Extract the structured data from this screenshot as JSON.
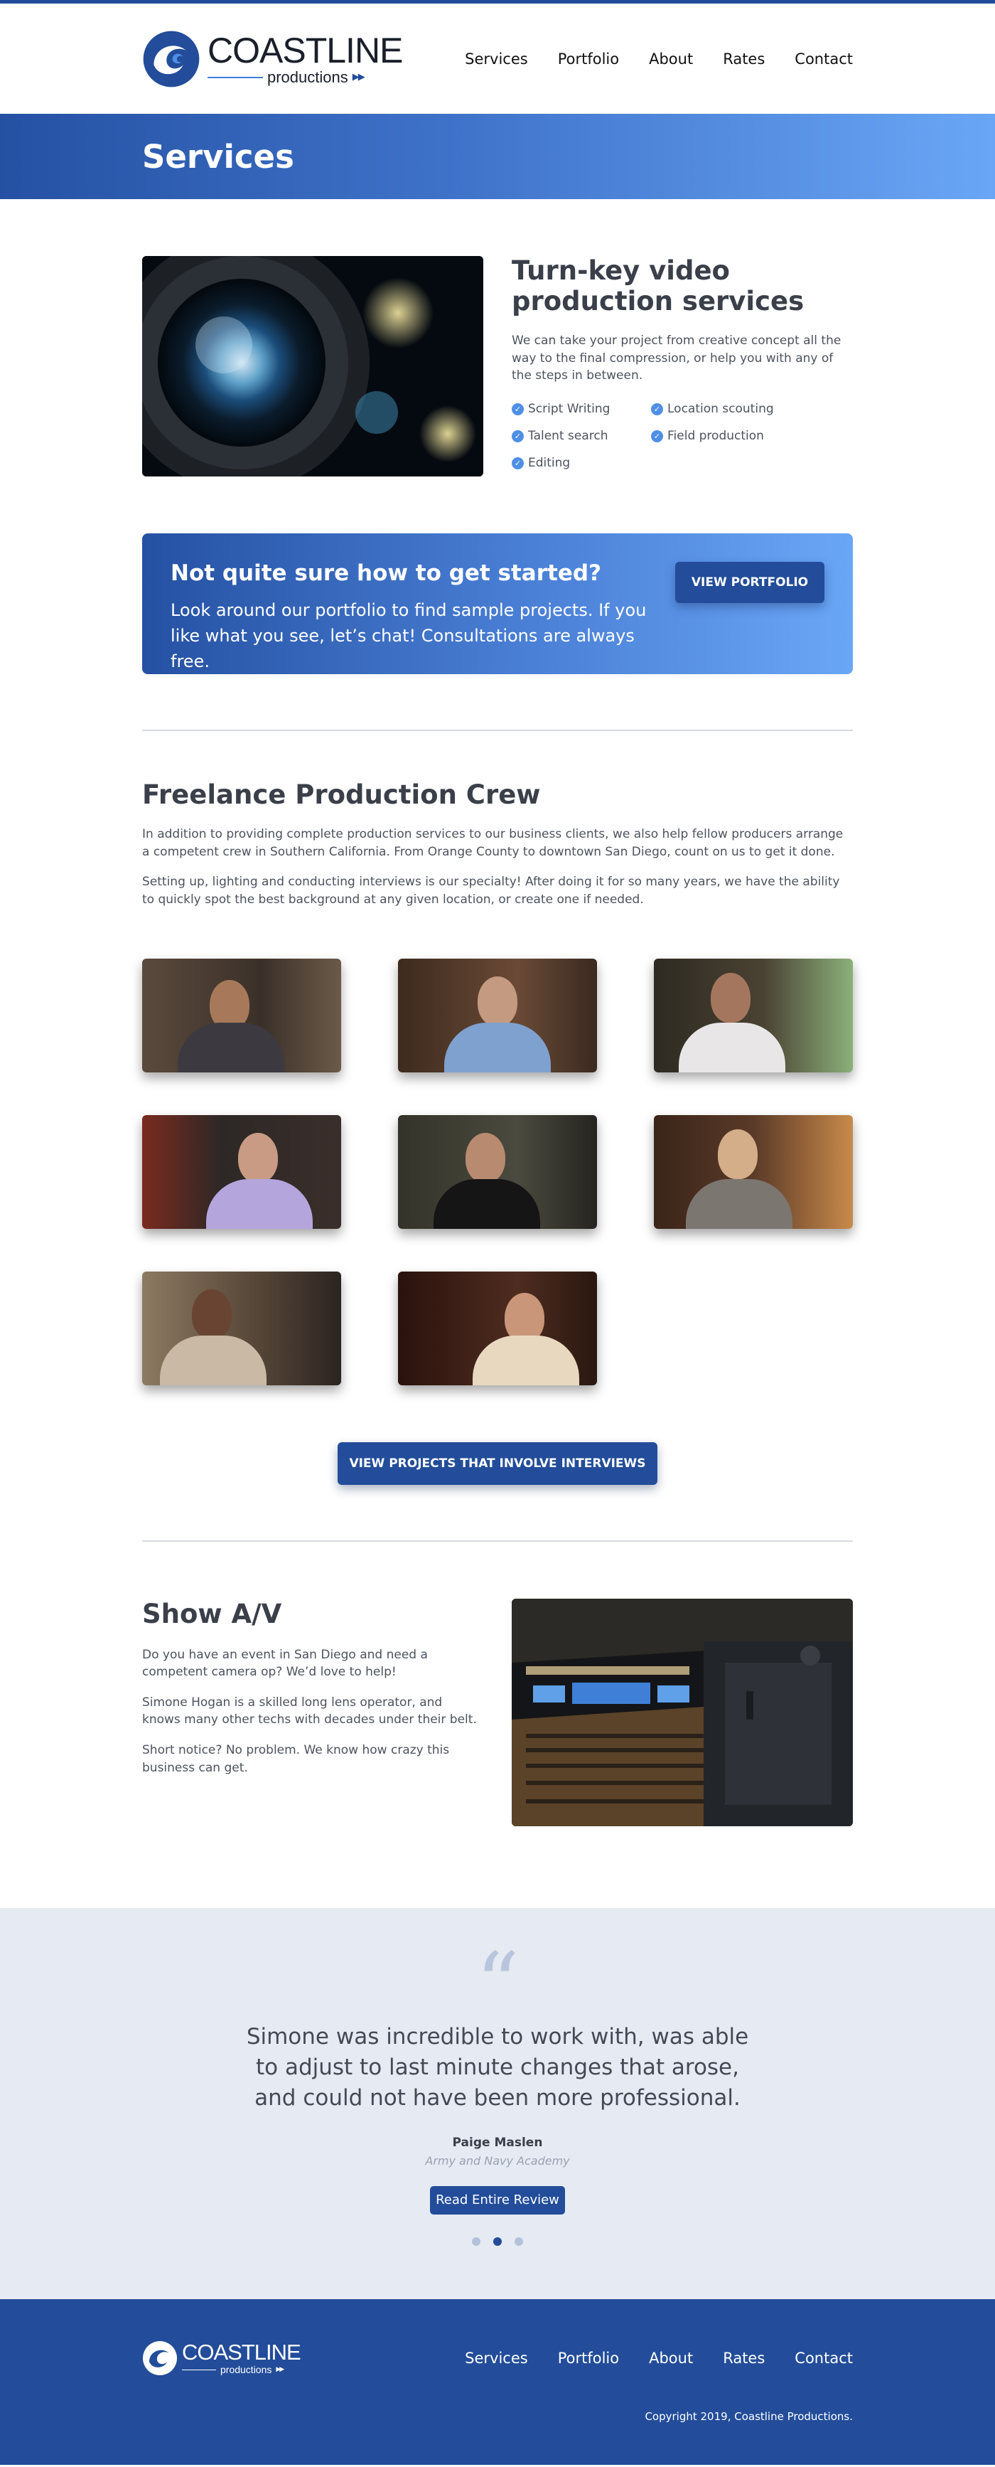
{
  "brand": {
    "name": "COASTLINE",
    "sub": "productions",
    "arrows": "▶▶"
  },
  "nav": {
    "items": [
      "Services",
      "Portfolio",
      "About",
      "Rates",
      "Contact"
    ]
  },
  "banner": {
    "title": "Services"
  },
  "intro": {
    "heading": "Turn-key video production services",
    "body": "We can take your project from creative concept all the way to the final compression, or help you with any of the steps in between.",
    "features": [
      "Script Writing",
      "Location scouting",
      "Talent search",
      "Field production",
      "Editing"
    ]
  },
  "cta": {
    "heading": "Not quite sure how to get started?",
    "body": "Look around our portfolio to find sample projects. If you like what you see, let’s chat! Consultations are always free.",
    "button": "VIEW PORTFOLIO"
  },
  "crew": {
    "heading": "Freelance Production Crew",
    "p1": "In addition to providing complete production services to our business clients, we also help fellow producers arrange a competent crew in Southern California. From Orange County to downtown San Diego, count on us to get it done.",
    "p2": "Setting up, lighting and conducting interviews is our specialty! After doing it for so many years, we have the ability to quickly spot the best background at any given location, or create one if needed.",
    "button": "VIEW PROJECTS THAT INVOLVE INTERVIEWS"
  },
  "show": {
    "heading": "Show A/V",
    "p1": "Do you have an event in San Diego and need a competent camera op? We’d love to help!",
    "p2": "Simone Hogan is a skilled long lens operator, and knows many other techs with decades under their belt.",
    "p3": "Short notice? No problem. We know how crazy this business can get."
  },
  "testimonial": {
    "quote_mark": "“",
    "text": "Simone was incredible to work with, was able to adjust to last minute changes that arose, and could not have been more professional.",
    "author": "Paige Maslen",
    "org": "Army and Navy Academy",
    "button": "Read Entire Review",
    "slide_count": 3,
    "active_slide": 2
  },
  "footer": {
    "copyright": "Copyright 2019, Coastline Productions."
  },
  "colors": {
    "brand_blue": "#234d9a",
    "accent_blue": "#4f8fe6",
    "testimonial_bg": "#e6eaf2"
  }
}
